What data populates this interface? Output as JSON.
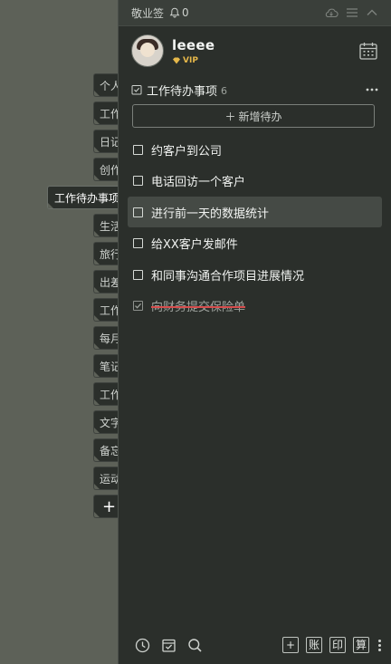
{
  "side_tabs": {
    "items": [
      "个人",
      "工作",
      "日记",
      "创作",
      "工作待办事项",
      "生活",
      "旅行",
      "出差",
      "工作",
      "每月",
      "笔记",
      "工作",
      "文字",
      "备忘",
      "运动"
    ],
    "active_index": 4,
    "add_label": "+"
  },
  "titlebar": {
    "app_name": "敬业签",
    "notification_count": "0"
  },
  "profile": {
    "username": "leeee",
    "badge": "VIP"
  },
  "section": {
    "title": "工作待办事项",
    "count": "6"
  },
  "add_button": {
    "label": "新增待办"
  },
  "todos": [
    {
      "text": "约客户到公司",
      "done": false
    },
    {
      "text": "电话回访一个客户",
      "done": false
    },
    {
      "text": "进行前一天的数据统计",
      "done": false,
      "highlight": true
    },
    {
      "text": "给XX客户发邮件",
      "done": false
    },
    {
      "text": "和同事沟通合作项目进展情况",
      "done": false
    },
    {
      "text": "向财务提交保险单",
      "done": true
    }
  ],
  "bottom_bar": {
    "right_buttons": [
      "+",
      "账",
      "印",
      "算"
    ]
  },
  "colors": {
    "panel_bg": "#2b2f2b",
    "desktop_bg": "#5d6158",
    "vip": "#e6b84a",
    "strike": "#d64d4d"
  }
}
